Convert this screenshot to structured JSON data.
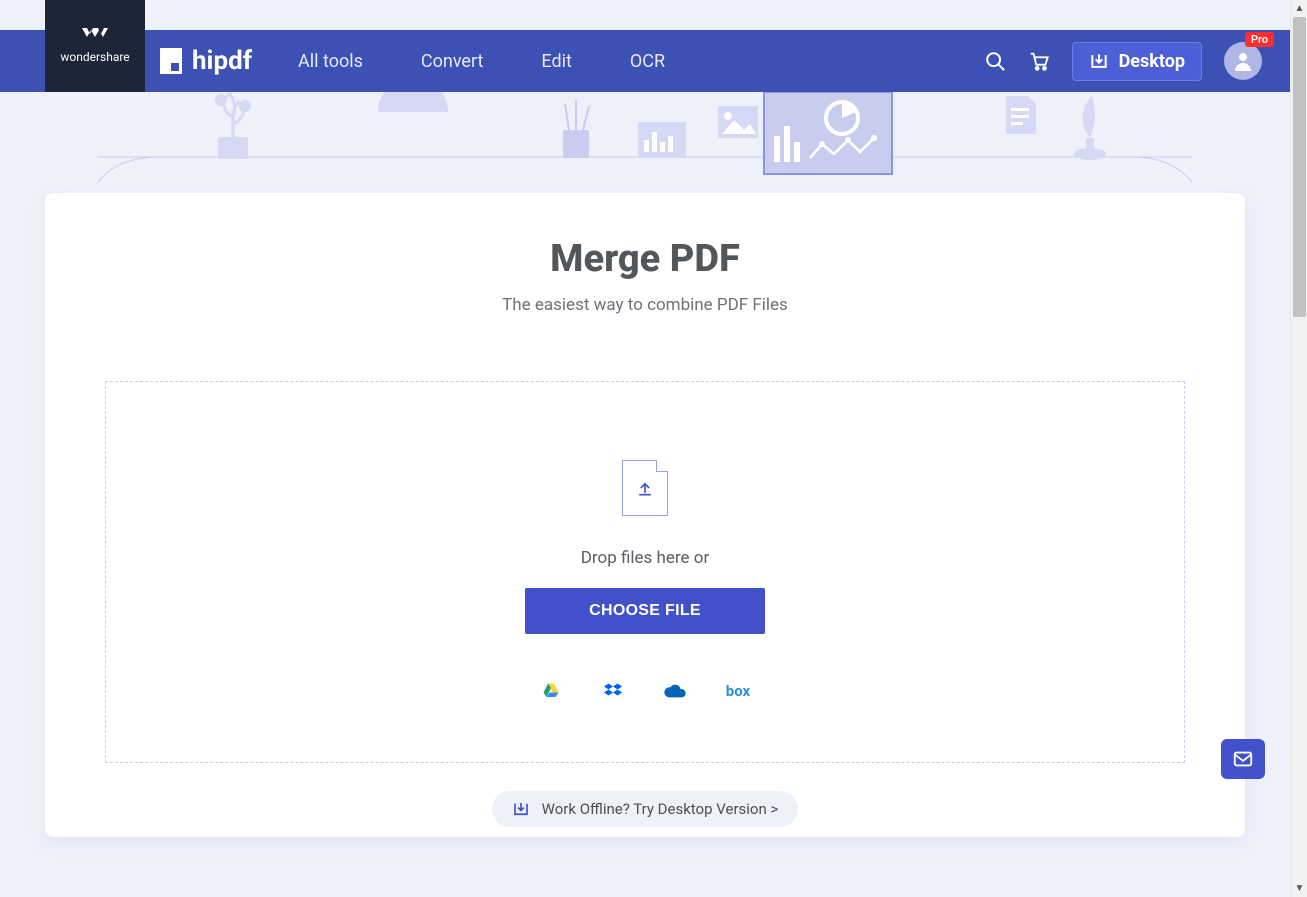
{
  "brand": {
    "company": "wondershare",
    "product": "hipdf"
  },
  "nav": {
    "items": [
      "All tools",
      "Convert",
      "Edit",
      "OCR"
    ],
    "desktop_label": "Desktop",
    "pro_badge": "Pro"
  },
  "page": {
    "title": "Merge PDF",
    "subtitle": "The easiest way to combine PDF Files"
  },
  "dropzone": {
    "drop_text": "Drop files here or",
    "choose_label": "CHOOSE FILE"
  },
  "cloud_sources": {
    "box_label": "box"
  },
  "offline": {
    "label": "Work Offline? Try Desktop Version >"
  }
}
